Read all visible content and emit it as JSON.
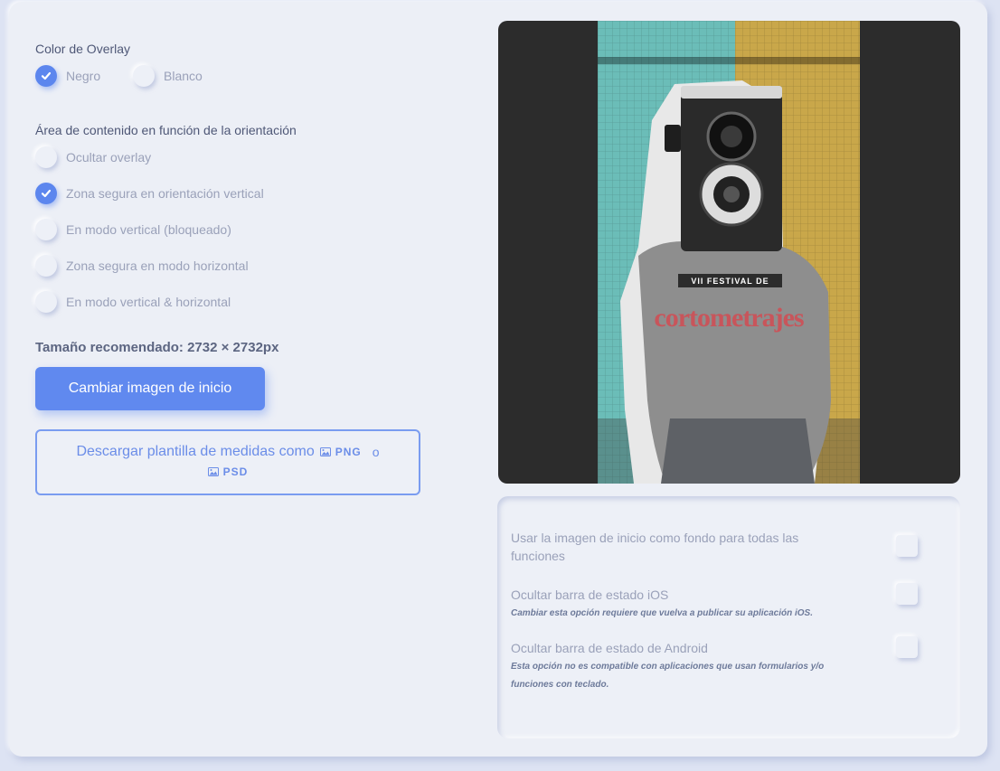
{
  "overlay": {
    "title": "Color de Overlay",
    "options": [
      {
        "label": "Negro",
        "checked": true
      },
      {
        "label": "Blanco",
        "checked": false
      }
    ]
  },
  "content_area": {
    "title": "Área de contenido en función de la orientación",
    "options": [
      {
        "label": "Ocultar overlay",
        "checked": false
      },
      {
        "label": "Zona segura en orientación vertical",
        "checked": true
      },
      {
        "label": "En modo vertical (bloqueado)",
        "checked": false
      },
      {
        "label": "Zona segura en modo horizontal",
        "checked": false
      },
      {
        "label": "En modo vertical & horizontal",
        "checked": false
      }
    ]
  },
  "recommended_size": "Tamaño recomendado: 2732 × 2732px",
  "change_button": "Cambiar imagen de inicio",
  "download": {
    "text": "Descargar plantilla de medidas como",
    "png": "PNG",
    "or": "o",
    "psd": "PSD"
  },
  "poster": {
    "line1": "VII FESTIVAL DE",
    "line2": "cortometrajes"
  },
  "settings": [
    {
      "label": "Usar la imagen de inicio como fondo para todas las funciones",
      "note": "",
      "checked": false
    },
    {
      "label": "Ocultar barra de estado iOS",
      "note": "Cambiar esta opción requiere que vuelva a publicar su aplicación iOS.",
      "checked": false
    },
    {
      "label": "Ocultar barra de estado de Android",
      "note": "Esta opción no es compatible con aplicaciones que usan formularios y/o funciones con teclado.",
      "checked": false
    }
  ],
  "colors": {
    "accent": "#6089ef",
    "background": "#eceff6"
  }
}
